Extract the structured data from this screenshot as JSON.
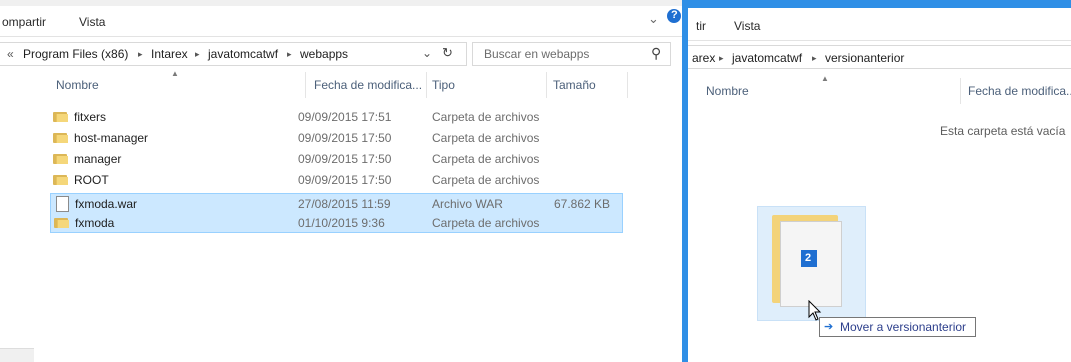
{
  "left": {
    "ribbon": {
      "share": "ompartir",
      "view": "Vista"
    },
    "breadcrumb": {
      "back_marker": "«",
      "parts": [
        "Program Files (x86)",
        "Intarex",
        "javatomcatwf",
        "webapps"
      ],
      "sep": "▸"
    },
    "search_placeholder": "Buscar en webapps",
    "columns": {
      "name": "Nombre",
      "date": "Fecha de modifica...",
      "type": "Tipo",
      "size": "Tamaño"
    },
    "files": [
      {
        "name": "fitxers",
        "date": "09/09/2015 17:51",
        "type": "Carpeta de archivos",
        "size": "",
        "kind": "folder",
        "selected": false
      },
      {
        "name": "host-manager",
        "date": "09/09/2015 17:50",
        "type": "Carpeta de archivos",
        "size": "",
        "kind": "folder",
        "selected": false
      },
      {
        "name": "manager",
        "date": "09/09/2015 17:50",
        "type": "Carpeta de archivos",
        "size": "",
        "kind": "folder",
        "selected": false
      },
      {
        "name": "ROOT",
        "date": "09/09/2015 17:50",
        "type": "Carpeta de archivos",
        "size": "",
        "kind": "folder",
        "selected": false
      },
      {
        "name": "fxmoda.war",
        "date": "27/08/2015 11:59",
        "type": "Archivo WAR",
        "size": "67.862 KB",
        "kind": "file",
        "selected": true
      },
      {
        "name": "fxmoda",
        "date": "01/10/2015 9:36",
        "type": "Carpeta de archivos",
        "size": "",
        "kind": "folder",
        "selected": true
      }
    ]
  },
  "right": {
    "ribbon": {
      "share": "tir",
      "view": "Vista"
    },
    "breadcrumb": {
      "parts": [
        "arex",
        "javatomcatwf",
        "versionanterior"
      ],
      "sep": "▸"
    },
    "columns": {
      "name": "Nombre",
      "date": "Fecha de modifica..."
    },
    "empty_text": "Esta carpeta está vacía"
  },
  "drag": {
    "count": "2",
    "tooltip": "Mover a versionanterior",
    "tooltip_arrow": "➔"
  },
  "icons": {
    "dropdown": "⌄",
    "help": "?",
    "refresh": "↻",
    "search": "⚲"
  },
  "colors": {
    "accent": "#2f8fe6",
    "selection": "#cce8ff",
    "count_badge": "#1f6fd1"
  }
}
